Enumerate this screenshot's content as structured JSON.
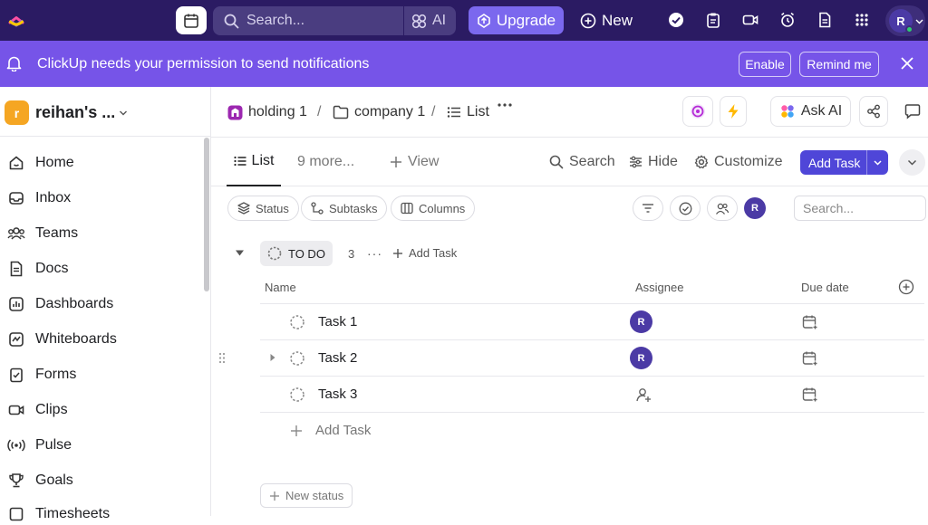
{
  "topbar": {
    "search_placeholder": "Search...",
    "ai_label": "AI",
    "upgrade_label": "Upgrade",
    "new_label": "New",
    "user_initial": "R"
  },
  "banner": {
    "message": "ClickUp needs your permission to send notifications",
    "enable_label": "Enable",
    "remind_label": "Remind me"
  },
  "workspace": {
    "initial": "r",
    "name": "reihan's ..."
  },
  "sidebar": {
    "items": [
      {
        "label": "Home",
        "icon": "home-icon"
      },
      {
        "label": "Inbox",
        "icon": "inbox-icon"
      },
      {
        "label": "Teams",
        "icon": "teams-icon"
      },
      {
        "label": "Docs",
        "icon": "docs-icon"
      },
      {
        "label": "Dashboards",
        "icon": "dashboards-icon"
      },
      {
        "label": "Whiteboards",
        "icon": "whiteboards-icon"
      },
      {
        "label": "Forms",
        "icon": "forms-icon"
      },
      {
        "label": "Clips",
        "icon": "clips-icon"
      },
      {
        "label": "Pulse",
        "icon": "pulse-icon"
      },
      {
        "label": "Goals",
        "icon": "goals-icon"
      },
      {
        "label": "Timesheets",
        "icon": "timesheets-icon"
      }
    ]
  },
  "breadcrumb": {
    "space": "holding 1",
    "folder": "company 1",
    "list": "List",
    "separator": "/"
  },
  "header": {
    "ask_ai_label": "Ask AI"
  },
  "viewbar": {
    "list_tab": "List",
    "more_tabs": "9 more...",
    "add_view": "View",
    "search": "Search",
    "hide": "Hide",
    "customize": "Customize",
    "add_task": "Add Task"
  },
  "filters": {
    "status": "Status",
    "subtasks": "Subtasks",
    "columns": "Columns",
    "assignee_initial": "R",
    "search_placeholder": "Search..."
  },
  "group": {
    "status": "TO DO",
    "count": "3",
    "more": "···",
    "add_task": "Add Task"
  },
  "table": {
    "columns": {
      "name": "Name",
      "assignee": "Assignee",
      "due": "Due date"
    },
    "rows": [
      {
        "name": "Task 1",
        "assignee": "R"
      },
      {
        "name": "Task 2",
        "assignee": "R"
      },
      {
        "name": "Task 3",
        "assignee": ""
      }
    ],
    "add_task": "Add Task",
    "new_status": "New status"
  },
  "colors": {
    "topbar_bg": "#2b1b63",
    "banner_bg": "#7654e8",
    "upgrade_bg": "#7b68ee",
    "primary_button": "#4f46d8",
    "avatar_bg": "#4b3aa5",
    "workspace_badge": "#f5a623"
  }
}
